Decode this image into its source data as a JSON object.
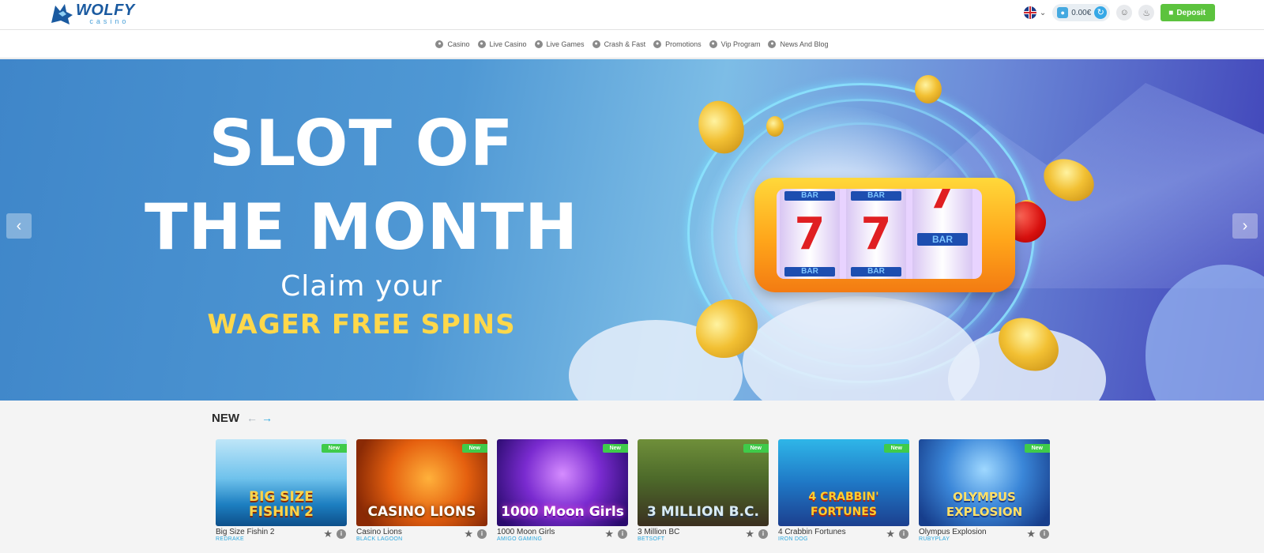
{
  "header": {
    "logo_word": "WOLFY",
    "logo_sub": "casino",
    "language": "English (UK)",
    "balance": "0.00€",
    "deposit_label": "Deposit",
    "icons": [
      "uk-flag-icon",
      "chevron-down-icon",
      "wallet-icon",
      "refresh-icon",
      "user-icon",
      "bell-icon",
      "deposit-icon"
    ]
  },
  "nav": {
    "items": [
      {
        "label": "Casino",
        "icon": "casino-chip-icon"
      },
      {
        "label": "Live Casino",
        "icon": "live-casino-icon"
      },
      {
        "label": "Live Games",
        "icon": "live-games-icon"
      },
      {
        "label": "Crash & Fast",
        "icon": "rocket-icon"
      },
      {
        "label": "Promotions",
        "icon": "gift-icon"
      },
      {
        "label": "Vip Program",
        "icon": "crown-icon"
      },
      {
        "label": "News And Blog",
        "icon": "news-icon"
      }
    ]
  },
  "banner": {
    "line1": "SLOT OF",
    "line2": "THE MONTH",
    "line3": "Claim your",
    "line4": "WAGER FREE SPINS",
    "reel_top": "BAR",
    "reel_mid": "7",
    "reel_bottom": "BAR",
    "reel3_mid": "BAR",
    "prev_icon": "chevron-left-icon",
    "next_icon": "chevron-right-icon"
  },
  "colors": {
    "brand": "#1a5aa0",
    "accent": "#2aa7df",
    "deposit": "#5cc33e",
    "new_badge": "#3fcb4a",
    "banner_highlight": "#ffd84a"
  },
  "new_section": {
    "title": "NEW",
    "prev_icon": "arrow-left-icon",
    "next_icon": "arrow-right-icon",
    "games": [
      {
        "name": "Big Size Fishin 2",
        "provider": "REDRAKE",
        "badge": "New",
        "art_title": "BIG SIZE FISHIN'2"
      },
      {
        "name": "Casino Lions",
        "provider": "BLACK LAGOON",
        "badge": "New",
        "art_title": "CASINO LIONS"
      },
      {
        "name": "1000 Moon Girls",
        "provider": "AMIGO GAMING",
        "badge": "New",
        "art_title": "1000 Moon Girls"
      },
      {
        "name": "3 Million BC",
        "provider": "BETSOFT",
        "badge": "New",
        "art_title": "3 MILLION B.C."
      },
      {
        "name": "4 Crabbin Fortunes",
        "provider": "IRON DOG",
        "badge": "New",
        "art_title": "4 CRABBIN' FORTUNES"
      },
      {
        "name": "Olympus Explosion",
        "provider": "RUBYPLAY",
        "badge": "New",
        "art_title": "OLYMPUS EXPLOSION"
      }
    ]
  }
}
